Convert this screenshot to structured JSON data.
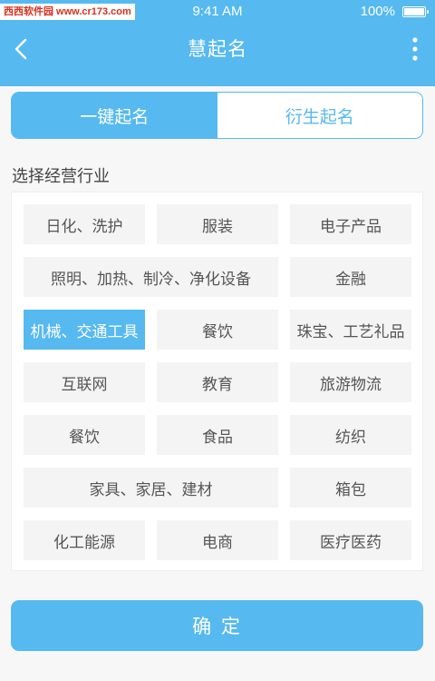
{
  "watermark": "西西软件园 www.cr173.com",
  "status_bar": {
    "time": "9:41 AM",
    "battery": "100%"
  },
  "header": {
    "title": "慧起名"
  },
  "tabs": [
    {
      "label": "一键起名",
      "active": true
    },
    {
      "label": "衍生起名",
      "active": false
    }
  ],
  "section_label": "选择经营行业",
  "industries": [
    {
      "label": "日化、洗护"
    },
    {
      "label": "服装"
    },
    {
      "label": "电子产品"
    },
    {
      "label": "照明、加热、制冷、净化设备"
    },
    {
      "label": "金融"
    },
    {
      "label": "机械、交通工具",
      "selected": true
    },
    {
      "label": "餐饮"
    },
    {
      "label": "珠宝、工艺礼品"
    },
    {
      "label": "互联网"
    },
    {
      "label": "教育"
    },
    {
      "label": "旅游物流"
    },
    {
      "label": "餐饮"
    },
    {
      "label": "食品"
    },
    {
      "label": "纺织"
    },
    {
      "label": "家具、家居、建材"
    },
    {
      "label": "箱包"
    },
    {
      "label": "化工能源"
    },
    {
      "label": "电商"
    },
    {
      "label": "医疗医药"
    }
  ],
  "confirm_label": "确  定",
  "colors": {
    "accent": "#56b9f0",
    "chip_bg": "#f4f4f4",
    "chip_text": "#555555"
  }
}
